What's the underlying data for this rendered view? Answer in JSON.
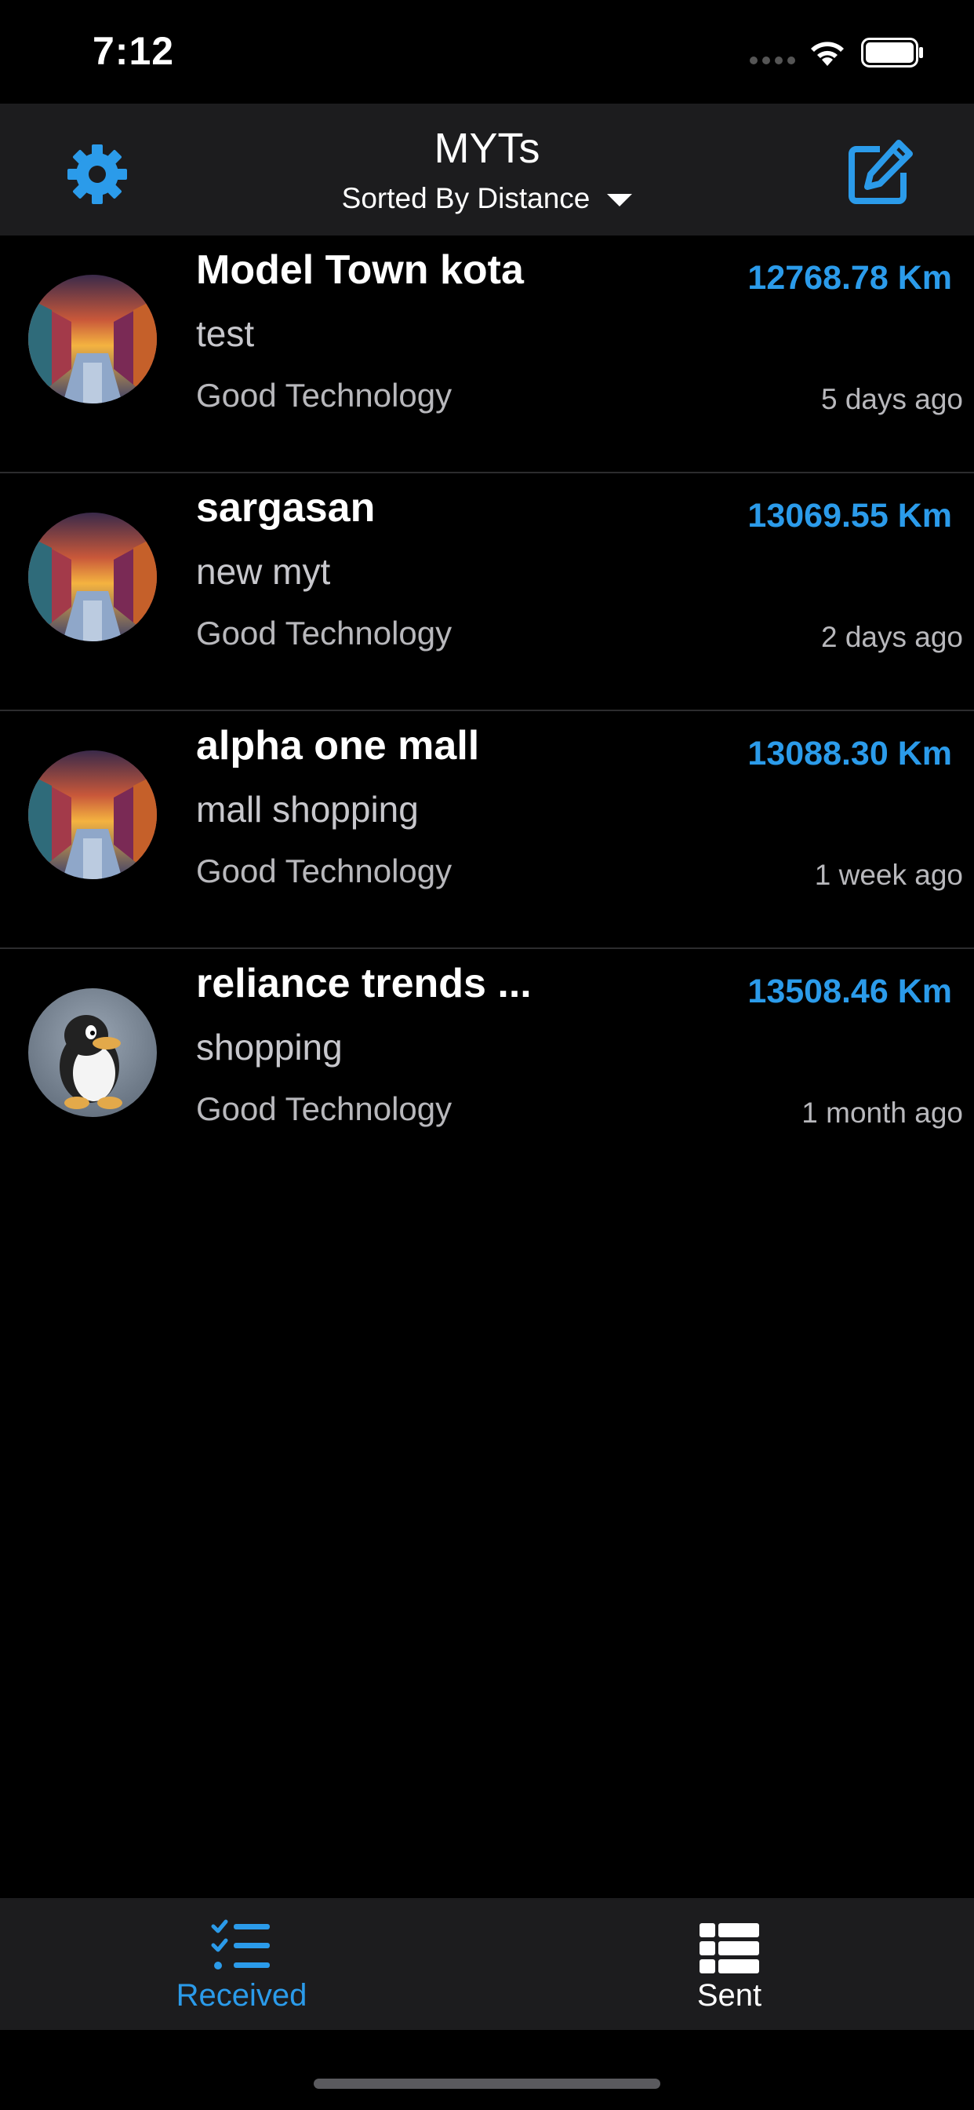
{
  "status_bar": {
    "time": "7:12"
  },
  "header": {
    "title": "MYTs",
    "sort_label": "Sorted By Distance"
  },
  "list": {
    "items": [
      {
        "title": "Model Town kota",
        "subtitle": "test",
        "company": "Good Technology",
        "distance": "12768.78 Km",
        "time": "5 days ago",
        "avatar": "sunset-canal-photo"
      },
      {
        "title": "sargasan",
        "subtitle": "new myt",
        "company": "Good Technology",
        "distance": "13069.55 Km",
        "time": "2 days ago",
        "avatar": "sunset-canal-photo"
      },
      {
        "title": "alpha one mall",
        "subtitle": "mall shopping",
        "company": "Good Technology",
        "distance": "13088.30 Km",
        "time": "1 week ago",
        "avatar": "sunset-canal-photo"
      },
      {
        "title": "reliance trends ...",
        "subtitle": "shopping",
        "company": "Good Technology",
        "distance": "13508.46 Km",
        "time": "1 month ago",
        "avatar": "penguin-photo"
      }
    ]
  },
  "tab_bar": {
    "tabs": [
      {
        "label": "Received",
        "icon": "checklist-icon",
        "active": true
      },
      {
        "label": "Sent",
        "icon": "table-list-icon",
        "active": false
      }
    ]
  },
  "colors": {
    "accent": "#2b9bea",
    "header_bg": "#1c1c1e",
    "background": "#000000"
  }
}
